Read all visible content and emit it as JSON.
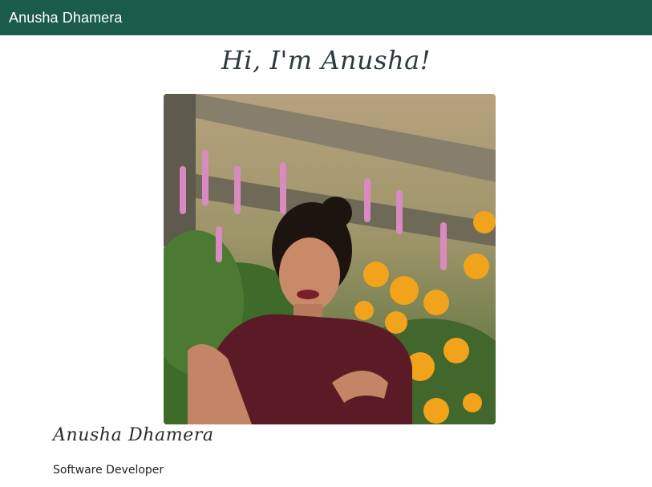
{
  "navbar": {
    "brand": "Anusha Dhamera",
    "background_color": "#1b5b4c"
  },
  "hero": {
    "greeting": "Hi, I'm Anusha!"
  },
  "profile": {
    "photo_icon": "profile-photo",
    "name": "Anusha Dhamera",
    "role": "Software Developer"
  }
}
